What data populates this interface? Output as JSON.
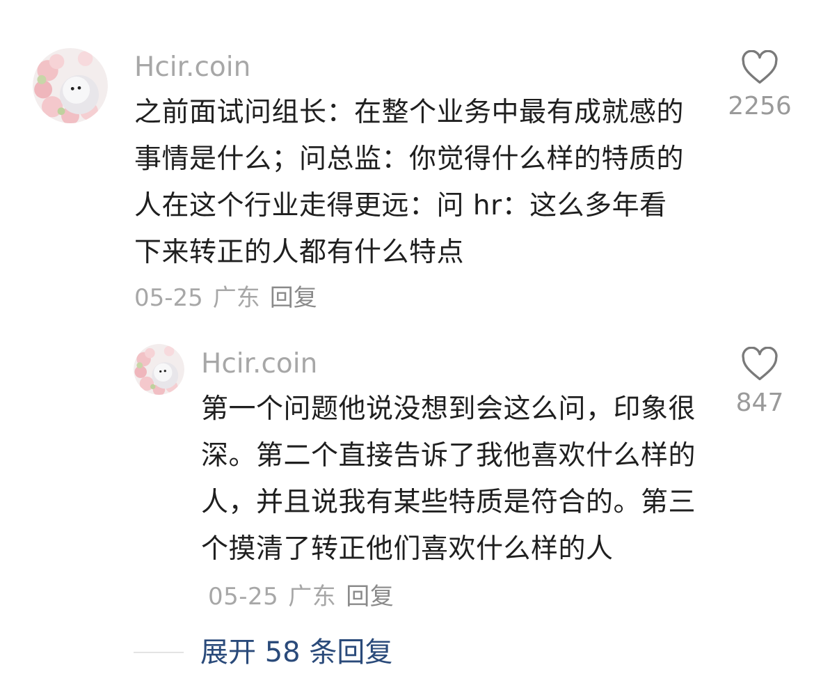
{
  "comments": [
    {
      "username": "Hcir.coin",
      "text": "之前面试问组长：在整个业务中最有成就感的事情是什么；问总监：你觉得什么样的特质的人在这个行业走得更远：问 hr：这么多年看下来转正的人都有什么特点",
      "date": "05-25",
      "location": "广东",
      "reply_label": "回复",
      "likes": "2256"
    },
    {
      "username": "Hcir.coin",
      "text": "第一个问题他说没想到会这么问，印象很深。第二个直接告诉了我他喜欢什么样的人，并且说我有某些特质是符合的。第三个摸清了转正他们喜欢什么样的人",
      "date": "05-25",
      "location": "广东",
      "reply_label": "回复",
      "likes": "847"
    }
  ],
  "expand_replies_label": "展开 58 条回复",
  "icons": {
    "like": "heart-outline-icon",
    "avatar": "avatar-pink-flowers"
  },
  "colors": {
    "text": "#1f1f1f",
    "meta": "#a7a7a7",
    "expand": "#2a4a7a"
  }
}
